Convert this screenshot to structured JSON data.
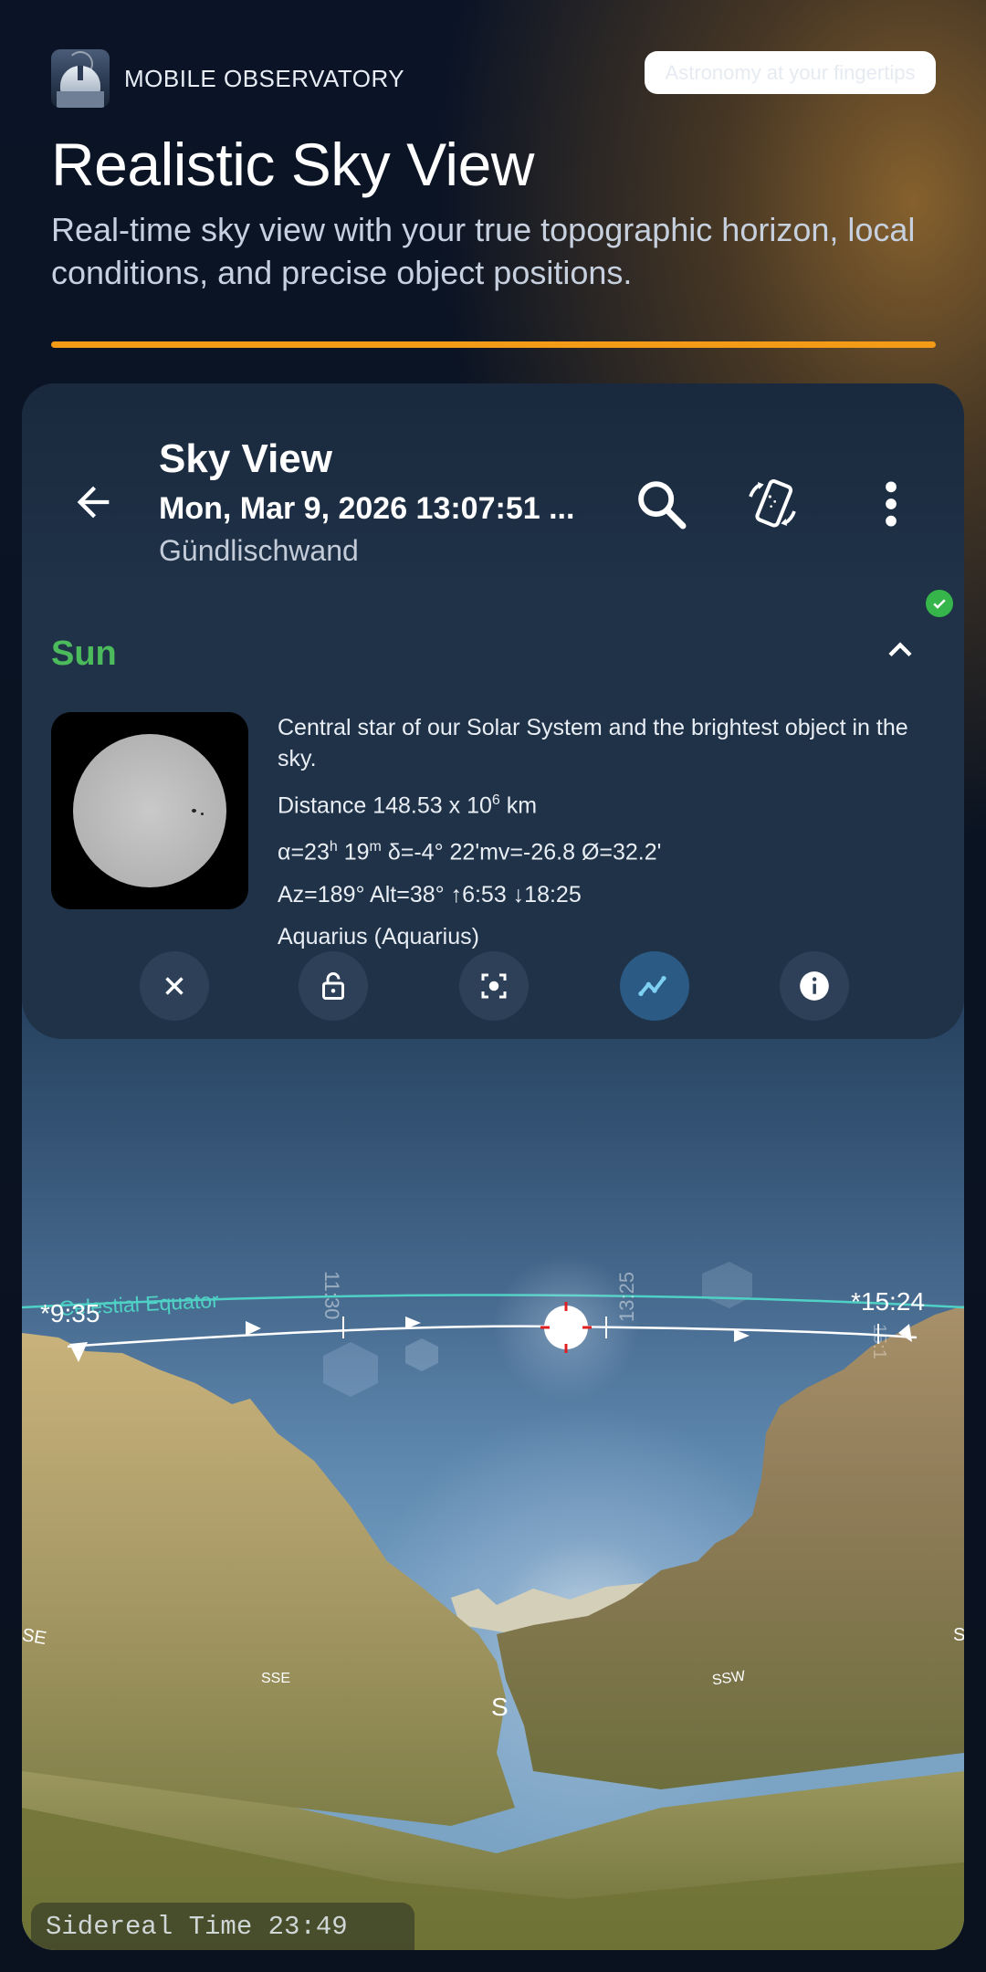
{
  "header": {
    "brand_name": "MOBILE OBSERVATORY",
    "tagline": "Astronomy at your fingertips",
    "title": "Realistic Sky View",
    "subtitle": "Real-time sky view with your true topographic horizon, local conditions, and precise object positions."
  },
  "appbar": {
    "title": "Sky View",
    "datetime": "Mon, Mar 9, 2026 13:07:51 ...",
    "location": "Gündlischwand"
  },
  "object": {
    "name": "Sun",
    "description": "Central star of our Solar System and the brightest object in the sky.",
    "distance_prefix": "Distance 148.53 x 10",
    "distance_exp": "6",
    "distance_unit": " km",
    "ra_prefix": "α=23",
    "ra_h": "h",
    "ra_mid": " 19",
    "ra_m": "m",
    "ra_rest": " δ=-4° 22'mv=-26.8 Ø=32.2'",
    "azalt": "Az=189° Alt=38° ↑6:53 ↓18:25",
    "constellation": "Aquarius (Aquarius)"
  },
  "sky": {
    "celestial_equator": "Celestial Equator",
    "rise_time": "*9:35",
    "set_time": "*15:24",
    "tick_1130": "11:30",
    "tick_1325": "13:25",
    "tick_right": "15:1",
    "compass_se": "SE",
    "compass_sse": "SSE",
    "compass_s": "S",
    "compass_ssw": "SSW",
    "compass_sw": "S",
    "sidereal_time": "Sidereal Time 23:49"
  },
  "colors": {
    "accent_orange": "#f39a17",
    "object_green": "#4cbb5c",
    "equator_cyan": "#4fd1c5",
    "active_action": "#2b5a84"
  },
  "icons": [
    "back-arrow-icon",
    "search-icon",
    "phone-rotate-icon",
    "more-vert-icon",
    "chevron-up-icon",
    "check-circle-icon",
    "close-icon",
    "lock-icon",
    "center-focus-icon",
    "trajectory-icon",
    "info-icon"
  ]
}
